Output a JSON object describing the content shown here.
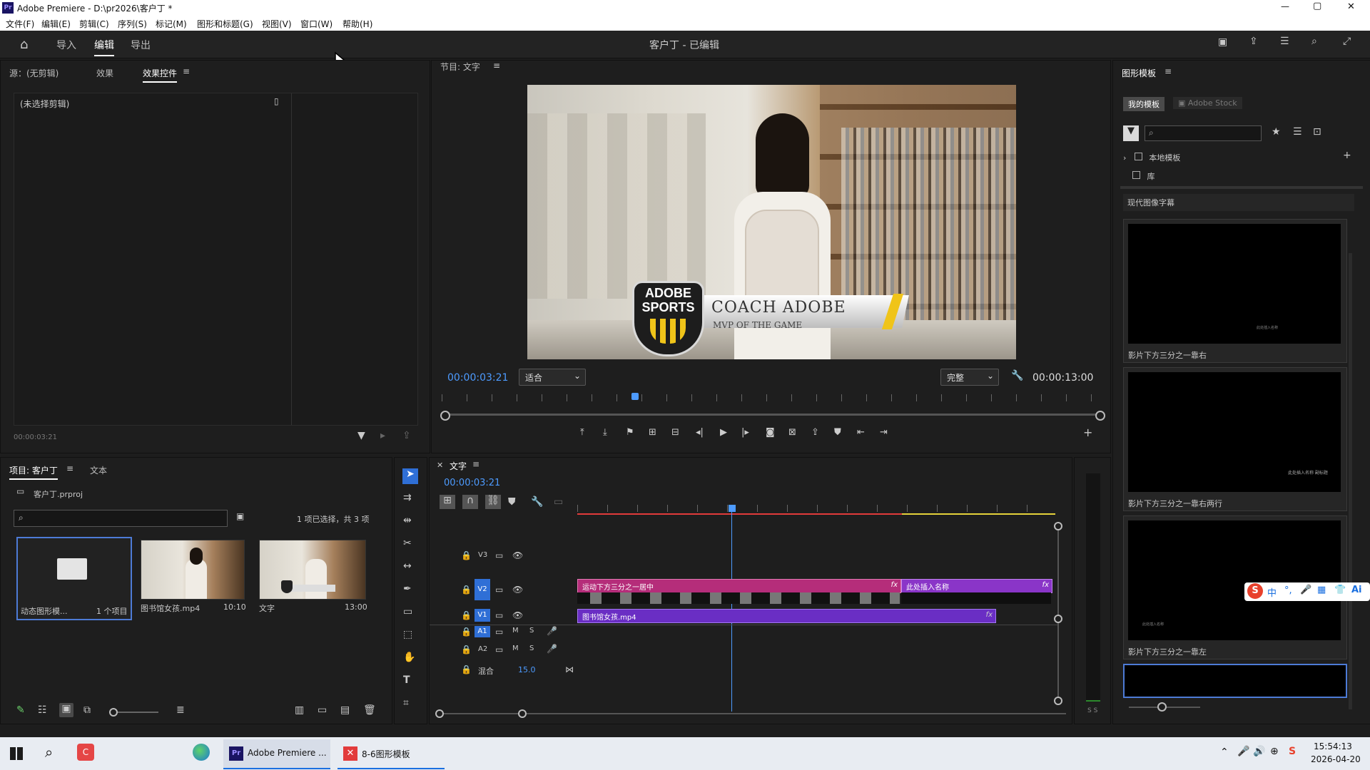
{
  "window": {
    "title": "Adobe Premiere - D:\\pr2026\\客户丁 *",
    "app_icon": "Pr",
    "controls": [
      "—",
      "▢",
      "✕"
    ]
  },
  "menu": [
    "文件(F)",
    "编辑(E)",
    "剪辑(C)",
    "序列(S)",
    "标记(M)",
    "图形和标题(G)",
    "视图(V)",
    "窗口(W)",
    "帮助(H)"
  ],
  "topnav": {
    "tabs": [
      "导入",
      "编辑",
      "导出"
    ],
    "active": "编辑",
    "project_title": "客户丁 - 已编辑"
  },
  "source_panel": {
    "tabs": [
      "源：(无剪辑)",
      "效果",
      "效果控件"
    ],
    "active": "效果控件",
    "no_clip": "(未选择剪辑)",
    "timecode": "00:00:03:21"
  },
  "program": {
    "title": "节目: 文字",
    "timecode_in": "00:00:03:21",
    "zoom": "适合",
    "quality": "完整",
    "duration": "00:00:13:00",
    "overlay": {
      "logo_top": "ADOBE",
      "logo_bottom": "SPORTS",
      "name": "COACH ADOBE",
      "sub": "MVP OF THE GAME"
    }
  },
  "project": {
    "tabs": [
      "项目: 客户丁",
      "文本"
    ],
    "file": "客户丁.prproj",
    "selection": "1 项已选择，共 3 项",
    "items": [
      {
        "name": "动态图形模...",
        "meta": "1 个项目"
      },
      {
        "name": "图书馆女孩.mp4",
        "meta": "10:10"
      },
      {
        "name": "文字",
        "meta": "13:00"
      }
    ]
  },
  "timeline": {
    "title": "文字",
    "timecode": "00:00:03:21",
    "tracks": [
      {
        "label": "V3"
      },
      {
        "label": "V2"
      },
      {
        "label": "V1"
      },
      {
        "label": "A1",
        "m": "M",
        "s": "S"
      },
      {
        "label": "A2",
        "m": "M",
        "s": "S"
      }
    ],
    "mix_label": "混合",
    "mix_value": "15.0",
    "clips": [
      {
        "name": "运动下方三分之一居中",
        "fx": "fx"
      },
      {
        "name": "此处插入名称",
        "fx": "fx"
      },
      {
        "name": "图书馆女孩.mp4",
        "fx": "fx"
      }
    ]
  },
  "graphics": {
    "title": "图形模板",
    "tabs": [
      "我的模板",
      "Adobe Stock"
    ],
    "tree": [
      "本地模板",
      "库"
    ],
    "section": "现代图像字幕",
    "templates": [
      {
        "name": "影片下方三分之一靠右",
        "inner": "此处插入名称"
      },
      {
        "name": "影片下方三分之一靠右两行",
        "inner": "此处插入名称 副标题"
      },
      {
        "name": "影片下方三分之一靠左",
        "inner": "此处插入名称"
      }
    ]
  },
  "ime": {
    "brand": "S",
    "items": [
      "中",
      "°,",
      "🎤",
      "▦",
      "👕",
      "Ai"
    ]
  },
  "taskbar": {
    "apps": [
      "Adobe Premiere ...",
      "8-6图形模板"
    ],
    "time": "15:54:13",
    "date": "2026-04-20"
  }
}
